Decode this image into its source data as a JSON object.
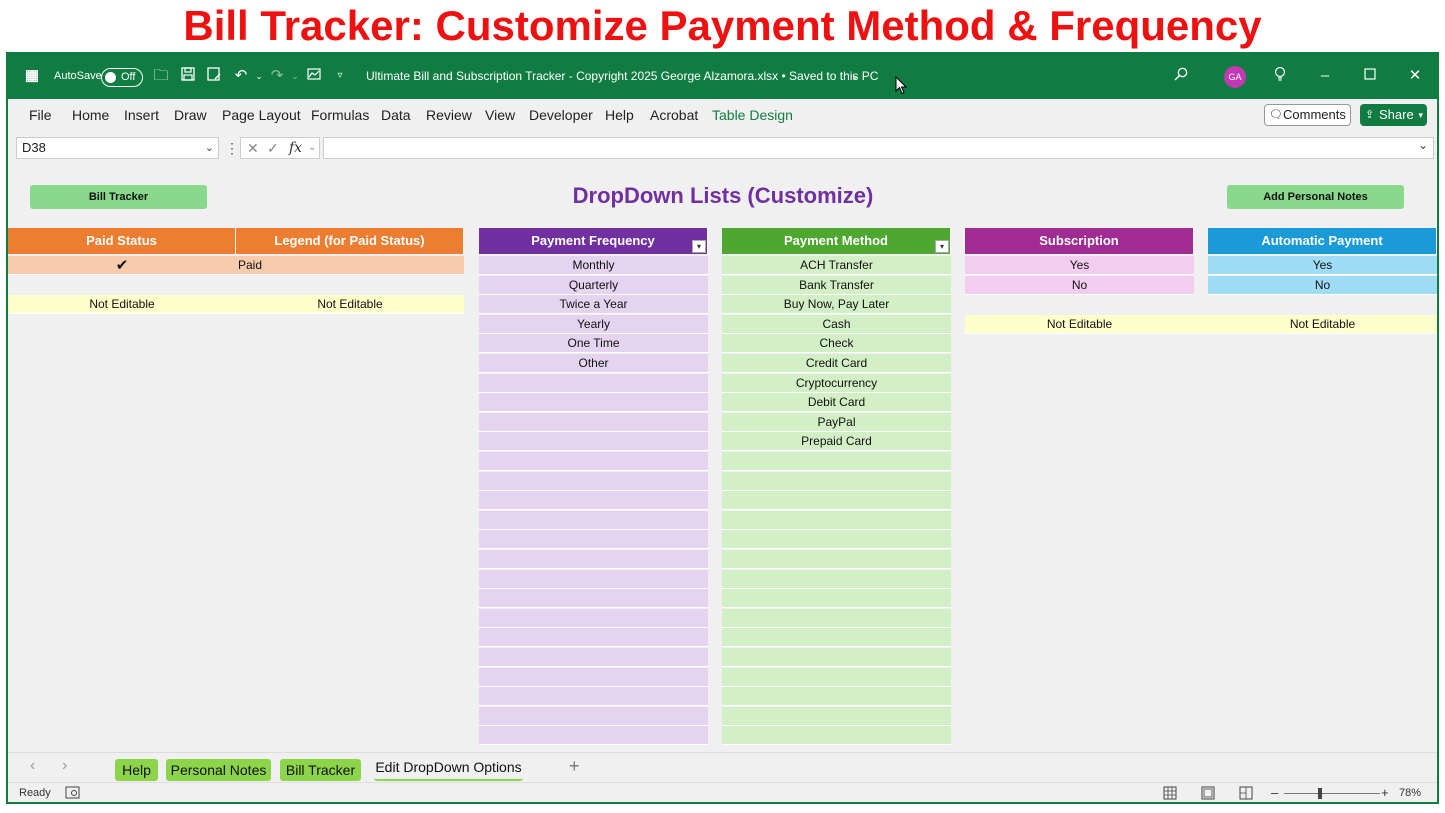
{
  "banner": "Bill Tracker: Customize Payment Method & Frequency",
  "titlebar": {
    "autosave_label": "AutoSave",
    "autosave_state": "Off",
    "filename": "Ultimate Bill and Subscription Tracker - Copyright 2025 George Alzamora.xlsx • Saved to this PC",
    "avatar_initials": "GA"
  },
  "menu": [
    "File",
    "Home",
    "Insert",
    "Draw",
    "Page Layout",
    "Formulas",
    "Data",
    "Review",
    "View",
    "Developer",
    "Help",
    "Acrobat",
    "Table Design"
  ],
  "comments_label": "Comments",
  "share_label": "Share",
  "namebox": "D38",
  "fx_label": "fx",
  "buttons": {
    "bill_tracker": "Bill Tracker",
    "add_notes": "Add Personal Notes"
  },
  "sheet_title": "DropDown Lists (Customize)",
  "headers": {
    "paid_status": "Paid Status",
    "legend": "Legend (for Paid Status)",
    "payment_frequency": "Payment Frequency",
    "payment_method": "Payment Method",
    "subscription": "Subscription",
    "automatic_payment": "Automatic Payment"
  },
  "paid_status": {
    "check": "✔",
    "legend_value": "Paid",
    "not_editable": "Not Editable"
  },
  "frequency_items": [
    "Monthly",
    "Quarterly",
    "Twice a Year",
    "Yearly",
    "One Time",
    "Other"
  ],
  "method_items": [
    "ACH Transfer",
    "Bank Transfer",
    "Buy Now, Pay Later",
    "Cash",
    "Check",
    "Credit Card",
    "Cryptocurrency",
    "Debit Card",
    "PayPal",
    "Prepaid Card"
  ],
  "subscription_items": [
    "Yes",
    "No"
  ],
  "automatic_items": [
    "Yes",
    "No"
  ],
  "not_editable": "Not Editable",
  "tabs": [
    "Help",
    "Personal Notes",
    "Bill Tracker",
    "Edit DropDown Options"
  ],
  "status": {
    "ready": "Ready",
    "zoom": "78%"
  },
  "colors": {
    "excel_green": "#107c41",
    "paid_header": "#ed7d31",
    "frequency_header": "#7030a0",
    "method_header": "#4ea72e",
    "subscription_header": "#a02b93",
    "automatic_header": "#1a9bd7"
  }
}
